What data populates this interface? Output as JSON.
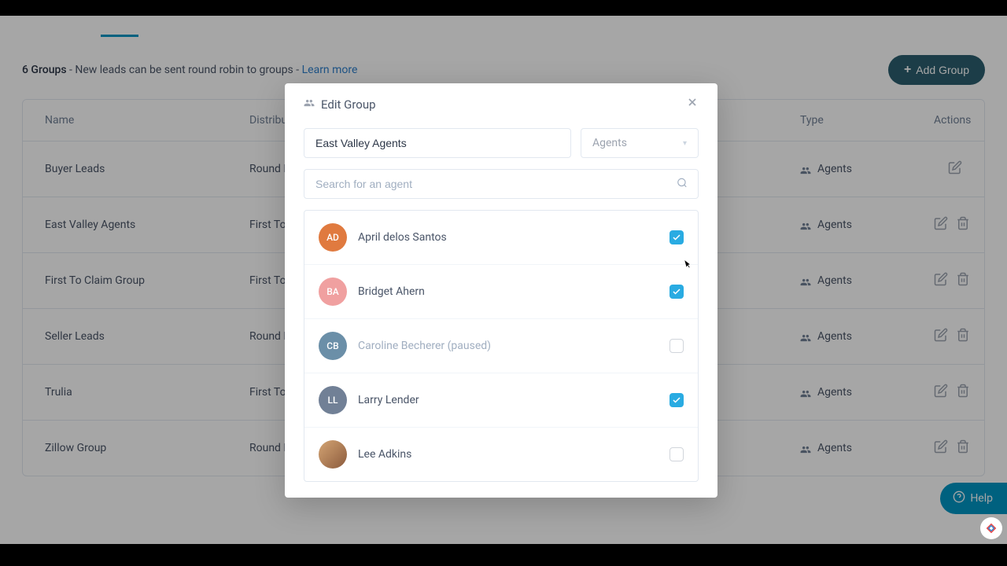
{
  "header": {
    "count_label": "6 Groups",
    "description": " - New leads can be sent round robin to groups - ",
    "learn_more": "Learn more",
    "add_button": "Add Group"
  },
  "table": {
    "columns": {
      "name": "Name",
      "distribution": "Distribution",
      "type": "Type",
      "actions": "Actions"
    },
    "rows": [
      {
        "name": "Buyer Leads",
        "distribution": "Round Robin",
        "type": "Agents",
        "deletable": false
      },
      {
        "name": "East Valley Agents",
        "distribution": "First To Claim",
        "type": "Agents",
        "deletable": true
      },
      {
        "name": "First To Claim Group",
        "distribution": "First To Claim",
        "type": "Agents",
        "deletable": true
      },
      {
        "name": "Seller Leads",
        "distribution": "Round Robin",
        "type": "Agents",
        "deletable": true
      },
      {
        "name": "Trulia",
        "distribution": "First To Claim",
        "type": "Agents",
        "deletable": true
      },
      {
        "name": "Zillow Group",
        "distribution": "Round Robin",
        "type": "Agents",
        "deletable": true
      }
    ]
  },
  "modal": {
    "title": "Edit Group",
    "group_name": "East Valley Agents",
    "type_value": "Agents",
    "search_placeholder": "Search for an agent",
    "agents": [
      {
        "initials": "AD",
        "name": "April delos Santos",
        "checked": true,
        "color": "#e07a3f",
        "muted": false,
        "photo": false
      },
      {
        "initials": "BA",
        "name": "Bridget Ahern",
        "checked": true,
        "color": "#f0a0a0",
        "muted": false,
        "photo": false
      },
      {
        "initials": "CB",
        "name": "Caroline Becherer (paused)",
        "checked": false,
        "color": "#6b8fa8",
        "muted": true,
        "photo": false
      },
      {
        "initials": "LL",
        "name": "Larry Lender",
        "checked": true,
        "color": "#718096",
        "muted": false,
        "photo": false
      },
      {
        "initials": "",
        "name": "Lee Adkins",
        "checked": false,
        "color": "#8b5a3c",
        "muted": false,
        "photo": true
      }
    ]
  },
  "help": {
    "label": "Help"
  }
}
